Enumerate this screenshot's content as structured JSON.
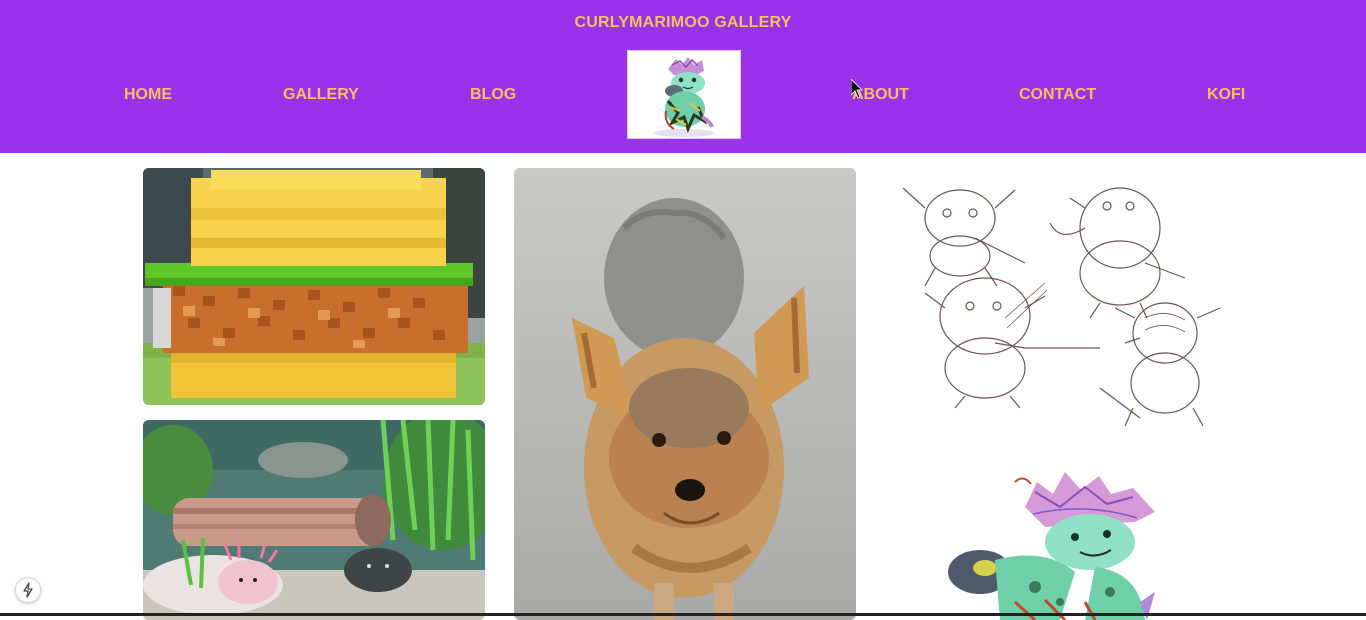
{
  "site": {
    "title": "CURLYMARIMOO GALLERY"
  },
  "nav": {
    "home": "HOME",
    "gallery": "GALLERY",
    "blog": "BLOG",
    "about": "ABOUT",
    "contact": "CONTACT",
    "kofi": "KOFI"
  },
  "colors": {
    "header_bg": "#9a31eb",
    "nav_text": "#f5c15c",
    "page_bg": "#ffffff"
  },
  "gallery": {
    "tiles": [
      {
        "subject": "voxel-burger-sculpture"
      },
      {
        "subject": "aquarium-axolotls"
      },
      {
        "subject": "yorkshire-terrier"
      },
      {
        "subject": "character-sketches"
      },
      {
        "subject": "colored-character-drawing"
      }
    ]
  },
  "icons": {
    "logo": "creature-logo-icon",
    "cursor": "mouse-pointer-icon",
    "floating_button": "lightning-bolt-icon"
  }
}
